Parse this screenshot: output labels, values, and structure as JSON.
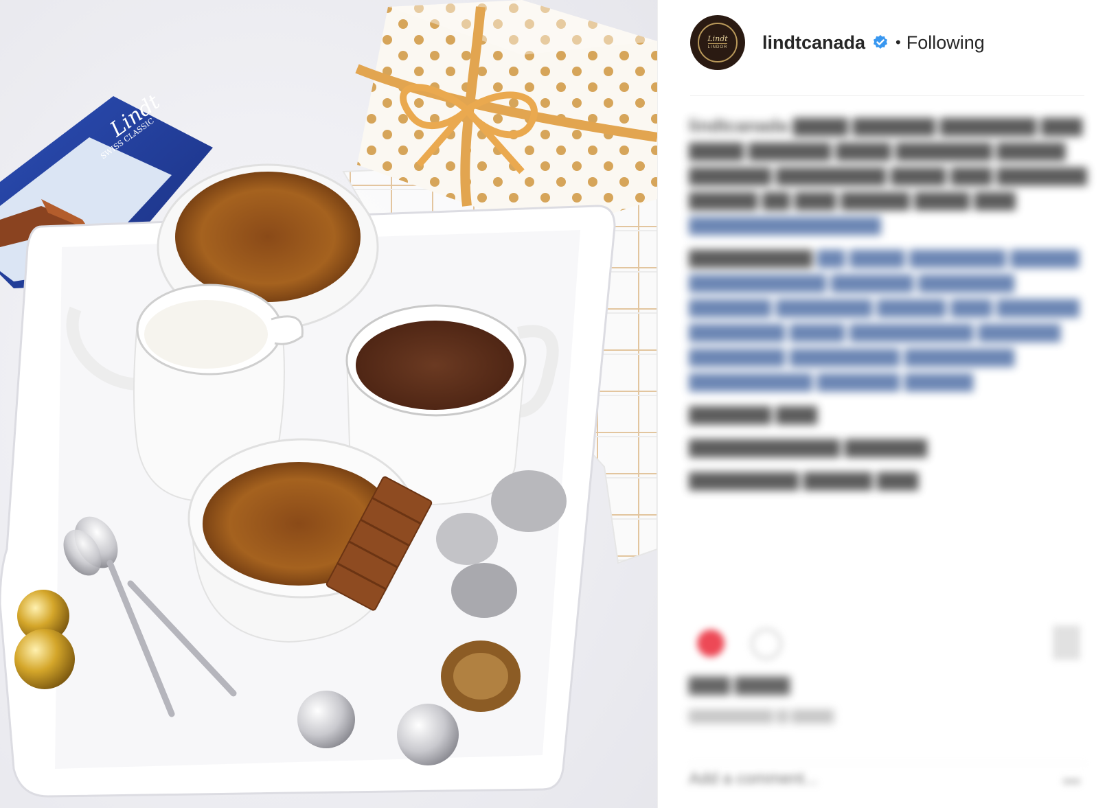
{
  "post": {
    "photo_alt": "",
    "chocolate_bar_brand": "Lindt",
    "chocolate_bar_variant": "SWISS CLASSIC"
  },
  "header": {
    "username": "lindtcanada",
    "avatar_brand": "Lindt",
    "avatar_sub": "LINDOR",
    "separator": "•",
    "follow_status": "Following",
    "verified_icon": "verified-badge-icon"
  },
  "caption": {
    "lines": [
      "lindtcanada",
      "",
      "",
      "",
      ""
    ]
  },
  "comment": {
    "placeholder": "Add a comment..."
  },
  "colors": {
    "verified_blue": "#3897f0",
    "text_primary": "#262626",
    "like_red": "#ed4956",
    "avatar_bg": "#2a1a12"
  }
}
